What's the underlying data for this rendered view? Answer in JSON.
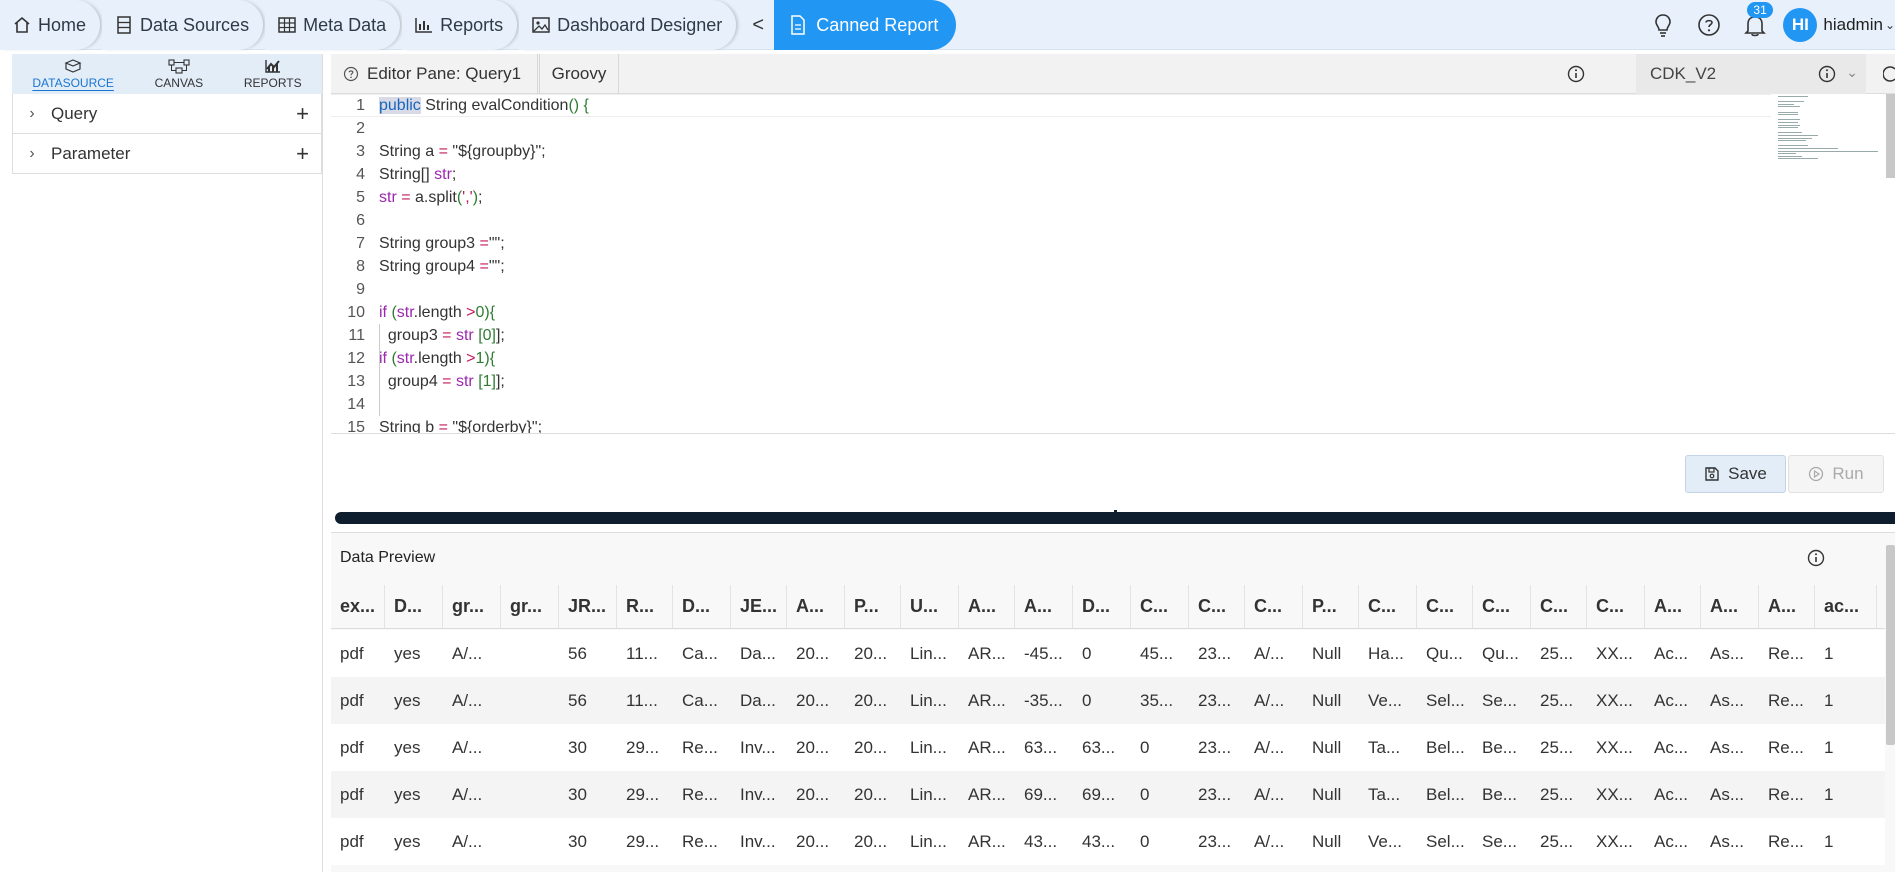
{
  "topbar": {
    "crumbs": [
      {
        "label": "Home",
        "icon": "home-icon"
      },
      {
        "label": "Data Sources",
        "icon": "database-icon"
      },
      {
        "label": "Meta Data",
        "icon": "table-icon"
      },
      {
        "label": "Reports",
        "icon": "bar-chart-icon"
      },
      {
        "label": "Dashboard Designer",
        "icon": "image-icon"
      }
    ],
    "back_label": "<",
    "active": {
      "label": "Canned Report",
      "icon": "document-icon"
    },
    "notifications_count": "31",
    "avatar_initials": "HI",
    "username": "hiadmin"
  },
  "left_panel": {
    "tabs": [
      {
        "label": "DATASOURCE",
        "icon": "datasource-icon",
        "active": true
      },
      {
        "label": "CANVAS",
        "icon": "canvas-icon",
        "active": false
      },
      {
        "label": "REPORTS",
        "icon": "reports-icon",
        "active": false
      }
    ],
    "tree": [
      {
        "label": "Query"
      },
      {
        "label": "Parameter"
      }
    ]
  },
  "editor": {
    "pane_title": "Editor Pane: Query1",
    "language": "Groovy",
    "datasource": "CDK_V2",
    "code_lines": [
      {
        "n": "1",
        "parts": [
          [
            "kwsel",
            "public"
          ],
          [
            "txt",
            " String evalCondition"
          ],
          [
            "pun",
            "() {"
          ]
        ]
      },
      {
        "n": "2",
        "parts": []
      },
      {
        "n": "3",
        "parts": [
          [
            "txt",
            "String a "
          ],
          [
            "op",
            "="
          ],
          [
            "txt",
            " \"${groupby}\";"
          ]
        ]
      },
      {
        "n": "4",
        "parts": [
          [
            "txt",
            "String[] "
          ],
          [
            "kw",
            "str"
          ],
          [
            "txt",
            ";"
          ]
        ]
      },
      {
        "n": "5",
        "parts": [
          [
            "kw",
            "str"
          ],
          [
            "txt",
            " "
          ],
          [
            "op",
            "="
          ],
          [
            "txt",
            " a.split"
          ],
          [
            "pun",
            "("
          ],
          [
            "op",
            "','"
          ],
          [
            "pun",
            ")"
          ],
          [
            "txt",
            ";"
          ]
        ]
      },
      {
        "n": "6",
        "parts": []
      },
      {
        "n": "7",
        "parts": [
          [
            "txt",
            "String group3 "
          ],
          [
            "op",
            "="
          ],
          [
            "txt",
            "\"\";"
          ]
        ]
      },
      {
        "n": "8",
        "parts": [
          [
            "txt",
            "String group4 "
          ],
          [
            "op",
            "="
          ],
          [
            "txt",
            "\"\";"
          ]
        ]
      },
      {
        "n": "9",
        "parts": []
      },
      {
        "n": "10",
        "parts": [
          [
            "kw",
            "if"
          ],
          [
            "txt",
            " "
          ],
          [
            "pun",
            "("
          ],
          [
            "kw",
            "str"
          ],
          [
            "txt",
            ".length "
          ],
          [
            "op",
            ">"
          ],
          [
            "pun",
            "0){"
          ]
        ]
      },
      {
        "n": "11",
        "parts": [
          [
            "txt",
            "  group3 "
          ],
          [
            "op",
            "="
          ],
          [
            "txt",
            " "
          ],
          [
            "kw",
            "str"
          ],
          [
            "txt",
            " "
          ],
          [
            "pun",
            "[0]"
          ],
          [
            "txt",
            "];"
          ]
        ]
      },
      {
        "n": "12",
        "parts": [
          [
            "kw",
            "if"
          ],
          [
            "txt",
            " "
          ],
          [
            "pun",
            "("
          ],
          [
            "kw",
            "str"
          ],
          [
            "txt",
            ".length "
          ],
          [
            "op",
            ">"
          ],
          [
            "pun",
            "1){"
          ]
        ]
      },
      {
        "n": "13",
        "parts": [
          [
            "txt",
            "  group4 "
          ],
          [
            "op",
            "="
          ],
          [
            "txt",
            " "
          ],
          [
            "kw",
            "str"
          ],
          [
            "txt",
            " "
          ],
          [
            "pun",
            "[1]"
          ],
          [
            "txt",
            "];"
          ]
        ]
      },
      {
        "n": "14",
        "parts": []
      },
      {
        "n": "15",
        "parts": [
          [
            "txt",
            "String b "
          ],
          [
            "op",
            "="
          ],
          [
            "txt",
            " \"${orderby}\";"
          ]
        ]
      }
    ],
    "save_label": "Save",
    "run_label": "Run"
  },
  "data_preview": {
    "title": "Data Preview",
    "columns": [
      "ex...",
      "D...",
      "gr...",
      "gr...",
      "JR...",
      "R...",
      "D...",
      "JE...",
      "A...",
      "P...",
      "U...",
      "A...",
      "A...",
      "D...",
      "C...",
      "C...",
      "C...",
      "P...",
      "C...",
      "C...",
      "C...",
      "C...",
      "C...",
      "A...",
      "A...",
      "A...",
      "ac..."
    ],
    "rows": [
      [
        "pdf",
        "yes",
        "A/...",
        "",
        "56",
        "11...",
        "Ca...",
        "Da...",
        "20...",
        "20...",
        "Lin...",
        "AR...",
        "-45...",
        "0",
        "45...",
        "23...",
        "A/...",
        "Null",
        "Ha...",
        "Qu...",
        "Qu...",
        "25...",
        "XX...",
        "Ac...",
        "As...",
        "Re...",
        "1"
      ],
      [
        "pdf",
        "yes",
        "A/...",
        "",
        "56",
        "11...",
        "Ca...",
        "Da...",
        "20...",
        "20...",
        "Lin...",
        "AR...",
        "-35...",
        "0",
        "35...",
        "23...",
        "A/...",
        "Null",
        "Ve...",
        "Sel...",
        "Se...",
        "25...",
        "XX...",
        "Ac...",
        "As...",
        "Re...",
        "1"
      ],
      [
        "pdf",
        "yes",
        "A/...",
        "",
        "30",
        "29...",
        "Re...",
        "Inv...",
        "20...",
        "20...",
        "Lin...",
        "AR...",
        "63...",
        "63...",
        "0",
        "23...",
        "A/...",
        "Null",
        "Ta...",
        "Bel...",
        "Be...",
        "25...",
        "XX...",
        "Ac...",
        "As...",
        "Re...",
        "1"
      ],
      [
        "pdf",
        "yes",
        "A/...",
        "",
        "30",
        "29...",
        "Re...",
        "Inv...",
        "20...",
        "20...",
        "Lin...",
        "AR...",
        "69...",
        "69...",
        "0",
        "23...",
        "A/...",
        "Null",
        "Ta...",
        "Bel...",
        "Be...",
        "25...",
        "XX...",
        "Ac...",
        "As...",
        "Re...",
        "1"
      ],
      [
        "pdf",
        "yes",
        "A/...",
        "",
        "30",
        "29...",
        "Re...",
        "Inv...",
        "20...",
        "20...",
        "Lin...",
        "AR...",
        "43...",
        "43...",
        "0",
        "23...",
        "A/...",
        "Null",
        "Ve...",
        "Sel...",
        "Se...",
        "25...",
        "XX...",
        "Ac...",
        "As...",
        "Re...",
        "1"
      ]
    ]
  },
  "colors": {
    "accent": "#2196f3",
    "topbar_bg": "#e8f1fb",
    "splitter": "#0e1e2e"
  }
}
